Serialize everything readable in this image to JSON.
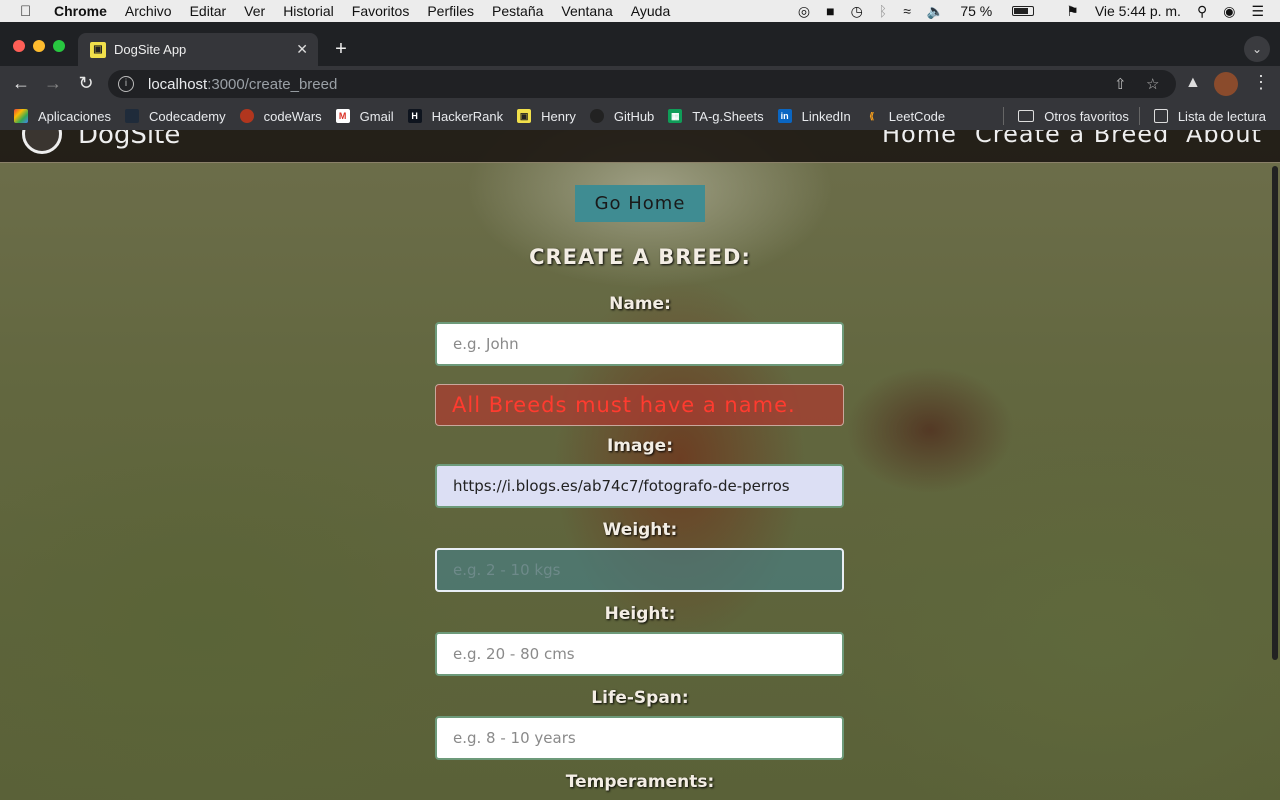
{
  "menubar": {
    "app": "Chrome",
    "items": [
      "Archivo",
      "Editar",
      "Ver",
      "Historial",
      "Favoritos",
      "Perfiles",
      "Pestaña",
      "Ventana",
      "Ayuda"
    ],
    "battery": "75 %",
    "clock": "Vie 5:44 p. m."
  },
  "browser": {
    "tab_title": "DogSite App",
    "url_host": "localhost",
    "url_path": ":3000/create_breed",
    "bookmarks": [
      "Aplicaciones",
      "Codecademy",
      "codeWars",
      "Gmail",
      "HackerRank",
      "Henry",
      "GitHub",
      "TA-g.Sheets",
      "LinkedIn",
      "LeetCode"
    ],
    "bookmarks_right": [
      "Otros favoritos",
      "Lista de lectura"
    ]
  },
  "site": {
    "name": "DogSite",
    "nav": [
      "Home",
      "Create a Breed",
      "About"
    ]
  },
  "form": {
    "go_home": "Go Home",
    "title": "CREATE A BREED:",
    "name_label": "Name:",
    "name_placeholder": "e.g. John",
    "name_error": "All Breeds must have a name.",
    "image_label": "Image:",
    "image_value": "https://i.blogs.es/ab74c7/fotografo-de-perros",
    "weight_label": "Weight:",
    "weight_placeholder": "e.g. 2 - 10 kgs",
    "height_label": "Height:",
    "height_placeholder": "e.g. 20 - 80 cms",
    "lifespan_label": "Life-Span:",
    "lifespan_placeholder": "e.g. 8 - 10 years",
    "temperaments_label": "Temperaments:"
  }
}
